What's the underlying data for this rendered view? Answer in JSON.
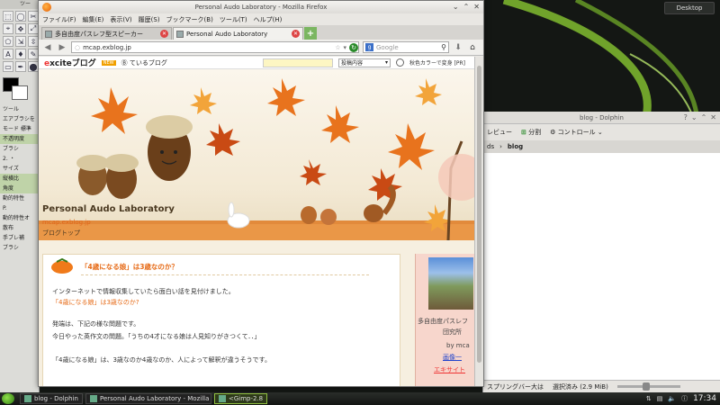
{
  "desktop": {
    "button_label": "Desktop"
  },
  "gimp": {
    "tab_label": "ツー",
    "tool_glyphs": [
      "⬚",
      "◯",
      "✂",
      "⌖",
      "✥",
      "⤢",
      "⬠",
      "⇲",
      "⇳",
      "A",
      "♦",
      "✎",
      "▭",
      "✒",
      "⬤"
    ],
    "tool_options_label": "ツール",
    "rows": [
      "エアブラシを",
      "モード  標準",
      "不透明度",
      "ブラシ",
      "2. ・",
      "サイズ",
      "縦横比",
      "角度",
      "動的特性",
      "P.",
      "動的特性オ",
      "散布",
      "手ブレ補",
      "ブラシ"
    ],
    "highlight_rows": [
      2,
      6,
      7
    ]
  },
  "dolphin": {
    "title": "blog - Dolphin",
    "toolbar": {
      "preview_label": "レビュー",
      "split_label": "分割",
      "control_label": "コントロール"
    },
    "path": {
      "prefix": "ds",
      "current": "blog"
    },
    "status": {
      "left_text": "スプリングバー大は",
      "selected_text": "選択済み (2.9 MiB)"
    }
  },
  "firefox": {
    "window_title": "Personal Audo Laboratory - Mozilla Firefox",
    "menu": [
      "ファイル(F)",
      "編集(E)",
      "表示(V)",
      "履歴(S)",
      "ブックマーク(B)",
      "ツール(T)",
      "ヘルプ(H)"
    ],
    "tabs": [
      {
        "label": "多自由度パスレフ型スピーカー",
        "active": false
      },
      {
        "label": "Personal Audo Laboratory",
        "active": true
      }
    ],
    "url": "mcap.exblog.jp",
    "search_placeholder": "Google"
  },
  "page": {
    "excite": {
      "logo_e": "e",
      "logo_rest": "xciteブログ",
      "new_badge": "NEW",
      "following_label": "Ⓑ ているブログ",
      "select_label": "投稿内容",
      "right_text": "秋色カラーで変身 [PR]"
    },
    "blog_title": "Personal Audo Laboratory",
    "blog_url": "mcap.exblog.jp",
    "blog_top": "ブログトップ",
    "post": {
      "title": "「4歳になる娘」は3歳なのか？",
      "lines": [
        "インターネットで情報収集していたら面白い話を見付けました。",
        "「4歳になる娘」は3歳なのか?",
        "発端は、下記の様な問題です。",
        "今日やった英作文の問題。「うちの4才になる娘は人見知りがきつくて．．」",
        "「4歳になる娘」は、3歳なのか4歳なのか、人によって解釈が違うそうです。"
      ]
    },
    "sidebar": {
      "line1": "多自由度パスレフ",
      "line2": "団究所",
      "line3": "by mca",
      "link": "画像一",
      "link2": "エキサイト"
    }
  },
  "taskbar": {
    "tasks": [
      {
        "label": "blog - Dolphin",
        "active": false
      },
      {
        "label": "Personal Audo Laboratory - Mozilla Fi",
        "active": false
      },
      {
        "label": "<Gimp-2.8",
        "active": true
      }
    ],
    "clock": "17:34"
  }
}
